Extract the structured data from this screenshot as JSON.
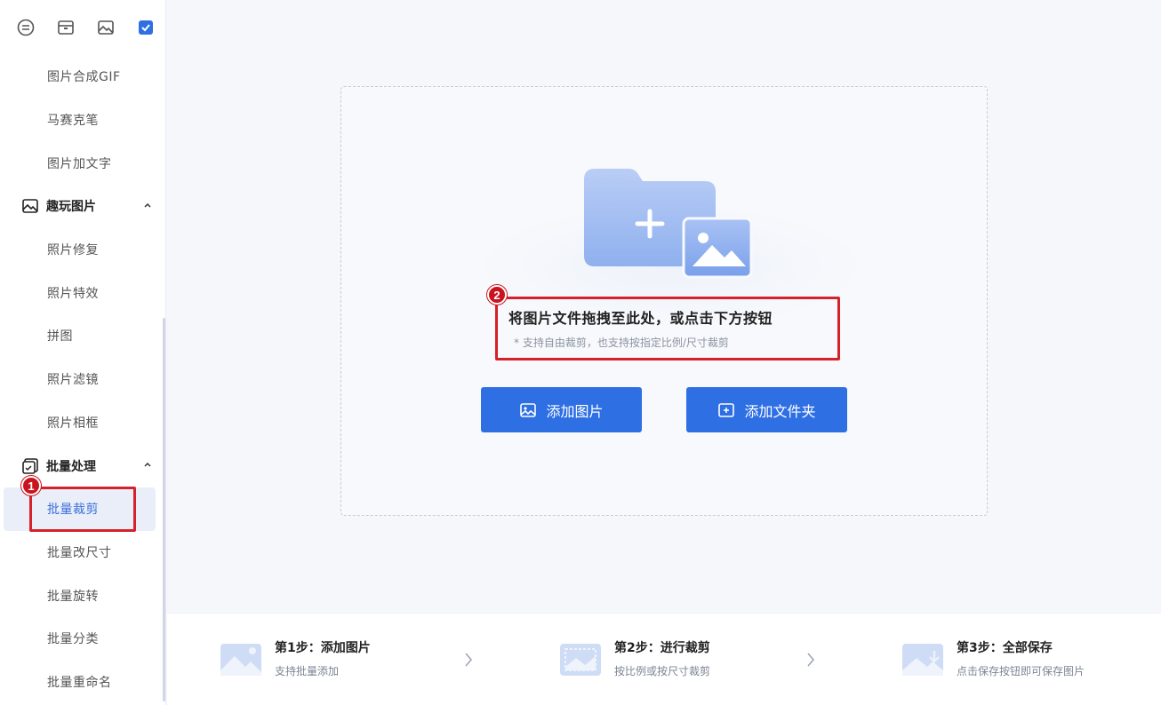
{
  "sidebar": {
    "top_icons": [
      "tool-circle-icon",
      "window-icon",
      "image-icon",
      "batch-icon"
    ],
    "items_before": [
      {
        "label": "图片合成GIF"
      },
      {
        "label": "马赛克笔"
      },
      {
        "label": "图片加文字"
      }
    ],
    "group1": {
      "label": "趣玩图片",
      "icon": "image-icon"
    },
    "group1_items": [
      {
        "label": "照片修复"
      },
      {
        "label": "照片特效"
      },
      {
        "label": "拼图"
      },
      {
        "label": "照片滤镜"
      },
      {
        "label": "照片相框"
      }
    ],
    "group2": {
      "label": "批量处理",
      "icon": "batch-icon"
    },
    "group2_items": [
      {
        "label": "批量裁剪",
        "active": true
      },
      {
        "label": "批量改尺寸"
      },
      {
        "label": "批量旋转"
      },
      {
        "label": "批量分类"
      },
      {
        "label": "批量重命名"
      }
    ]
  },
  "annotations": {
    "badge1": "1",
    "badge2": "2",
    "color": "#d6202a"
  },
  "dropzone": {
    "title": "将图片文件拖拽至此处，或点击下方按钮",
    "subtitle": "* 支持自由裁剪，也支持按指定比例/尺寸裁剪"
  },
  "buttons": {
    "add_image": "添加图片",
    "add_folder": "添加文件夹"
  },
  "steps": [
    {
      "title": "第1步：添加图片",
      "desc": "支持批量添加"
    },
    {
      "title": "第2步：进行裁剪",
      "desc": "按比例或按尺寸裁剪"
    },
    {
      "title": "第3步：全部保存",
      "desc": "点击保存按钮即可保存图片"
    }
  ],
  "colors": {
    "accent": "#2f6fe4",
    "active_bg": "#e9eef8",
    "active_text": "#3b6fd9"
  }
}
